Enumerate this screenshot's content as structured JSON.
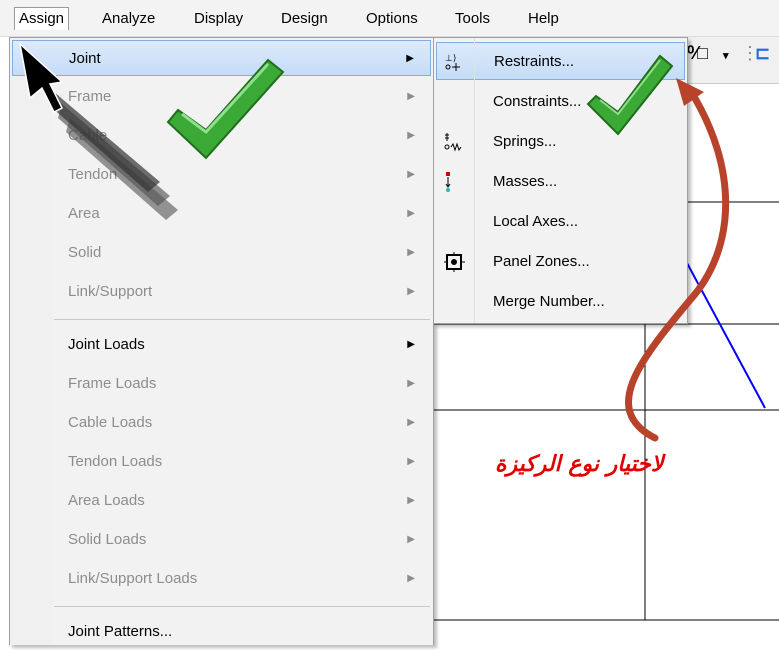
{
  "menubar": {
    "items": [
      "Assign",
      "Analyze",
      "Display",
      "Design",
      "Options",
      "Tools",
      "Help"
    ],
    "active": "Assign"
  },
  "assign_menu": {
    "items": [
      {
        "label": "Joint",
        "state": "highlighted",
        "submenu": true
      },
      {
        "label": "Frame",
        "state": "disabled",
        "submenu": true
      },
      {
        "label": "Cable",
        "state": "disabled",
        "submenu": true
      },
      {
        "label": "Tendon",
        "state": "disabled",
        "submenu": true
      },
      {
        "label": "Area",
        "state": "disabled",
        "submenu": true
      },
      {
        "label": "Solid",
        "state": "disabled",
        "submenu": true
      },
      {
        "label": "Link/Support",
        "state": "disabled",
        "submenu": true
      },
      {
        "label": "Joint Loads",
        "state": "enabled",
        "submenu": true
      },
      {
        "label": "Frame Loads",
        "state": "disabled",
        "submenu": true
      },
      {
        "label": "Cable Loads",
        "state": "disabled",
        "submenu": true
      },
      {
        "label": "Tendon Loads",
        "state": "disabled",
        "submenu": true
      },
      {
        "label": "Area Loads",
        "state": "disabled",
        "submenu": true
      },
      {
        "label": "Solid Loads",
        "state": "disabled",
        "submenu": true
      },
      {
        "label": "Link/Support Loads",
        "state": "disabled",
        "submenu": true
      },
      {
        "label": "Joint Patterns...",
        "state": "enabled",
        "submenu": false
      }
    ]
  },
  "joint_submenu": {
    "items": [
      {
        "label": "Restraints...",
        "icon": "restraints-icon",
        "state": "highlighted"
      },
      {
        "label": "Constraints...",
        "icon": "",
        "state": "enabled"
      },
      {
        "label": "Springs...",
        "icon": "springs-icon",
        "state": "enabled"
      },
      {
        "label": "Masses...",
        "icon": "masses-icon",
        "state": "enabled"
      },
      {
        "label": "Local Axes...",
        "icon": "",
        "state": "enabled"
      },
      {
        "label": "Panel Zones...",
        "icon": "panel-zones-icon",
        "state": "enabled"
      },
      {
        "label": "Merge Number...",
        "icon": "",
        "state": "enabled"
      }
    ]
  },
  "annotation": {
    "text": "لاختيار نوع الركيزة",
    "color": "#e10000"
  },
  "colors": {
    "highlight": "#c5dcf7",
    "checkmark": "#3aa935",
    "arrow": "#b8432b",
    "grid_line": "#000000",
    "frame_line": "#0000ff"
  }
}
